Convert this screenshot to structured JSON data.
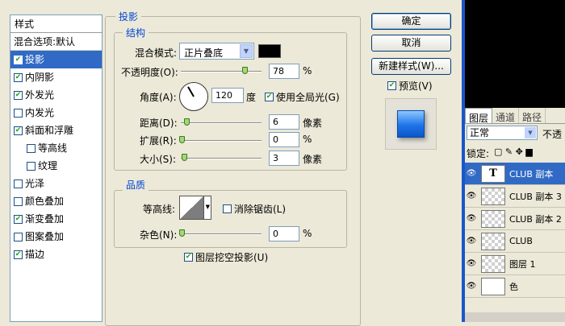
{
  "styles_panel": {
    "header": "样式",
    "blend_options": "混合选项:默认",
    "items": [
      {
        "label": "投影",
        "checked": true,
        "selected": true,
        "sub": false
      },
      {
        "label": "内阴影",
        "checked": true,
        "selected": false,
        "sub": false
      },
      {
        "label": "外发光",
        "checked": true,
        "selected": false,
        "sub": false
      },
      {
        "label": "内发光",
        "checked": false,
        "selected": false,
        "sub": false
      },
      {
        "label": "斜面和浮雕",
        "checked": true,
        "selected": false,
        "sub": false
      },
      {
        "label": "等高线",
        "checked": false,
        "selected": false,
        "sub": true
      },
      {
        "label": "纹理",
        "checked": false,
        "selected": false,
        "sub": true
      },
      {
        "label": "光泽",
        "checked": false,
        "selected": false,
        "sub": false
      },
      {
        "label": "颜色叠加",
        "checked": false,
        "selected": false,
        "sub": false
      },
      {
        "label": "渐变叠加",
        "checked": true,
        "selected": false,
        "sub": false
      },
      {
        "label": "图案叠加",
        "checked": false,
        "selected": false,
        "sub": false
      },
      {
        "label": "描边",
        "checked": true,
        "selected": false,
        "sub": false
      }
    ]
  },
  "drop_shadow": {
    "title": "投影",
    "structure": {
      "title": "结构",
      "blend_mode_label": "混合模式:",
      "blend_mode_value": "正片叠底",
      "blend_color": "#000000",
      "opacity_label": "不透明度(O):",
      "opacity_value": "78",
      "opacity_unit": "%",
      "angle_label": "角度(A):",
      "angle_value": "120",
      "angle_unit": "度",
      "global_light_label": "使用全局光(G)",
      "distance_label": "距离(D):",
      "distance_value": "6",
      "distance_unit": "像素",
      "spread_label": "扩展(R):",
      "spread_value": "0",
      "spread_unit": "%",
      "size_label": "大小(S):",
      "size_value": "3",
      "size_unit": "像素"
    },
    "quality": {
      "title": "品质",
      "contour_label": "等高线:",
      "antialias_label": "消除锯齿(L)",
      "noise_label": "杂色(N):",
      "noise_value": "0",
      "noise_unit": "%"
    },
    "knockout_label": "图层挖空投影(U)"
  },
  "buttons": {
    "ok": "确定",
    "cancel": "取消",
    "new_style": "新建样式(W)...",
    "preview_label": "预览(V)"
  },
  "layers_panel": {
    "tabs": [
      "图层",
      "通道",
      "路径"
    ],
    "blend_mode": "正常",
    "opacity_label": "不透",
    "lock_label": "锁定:",
    "layers": [
      {
        "name": "CLUB 副本",
        "type": "text",
        "selected": true
      },
      {
        "name": "CLUB 副本 3",
        "type": "raster",
        "selected": false
      },
      {
        "name": "CLUB 副本 2",
        "type": "raster",
        "selected": false
      },
      {
        "name": "CLUB",
        "type": "raster",
        "selected": false
      },
      {
        "name": "图层 1",
        "type": "raster",
        "selected": false
      },
      {
        "name": "色",
        "type": "adjust",
        "selected": false
      }
    ]
  },
  "colors": {
    "selection": "#316ac5",
    "group_title": "#0046d5",
    "preview_fill": "#1e74e8"
  }
}
